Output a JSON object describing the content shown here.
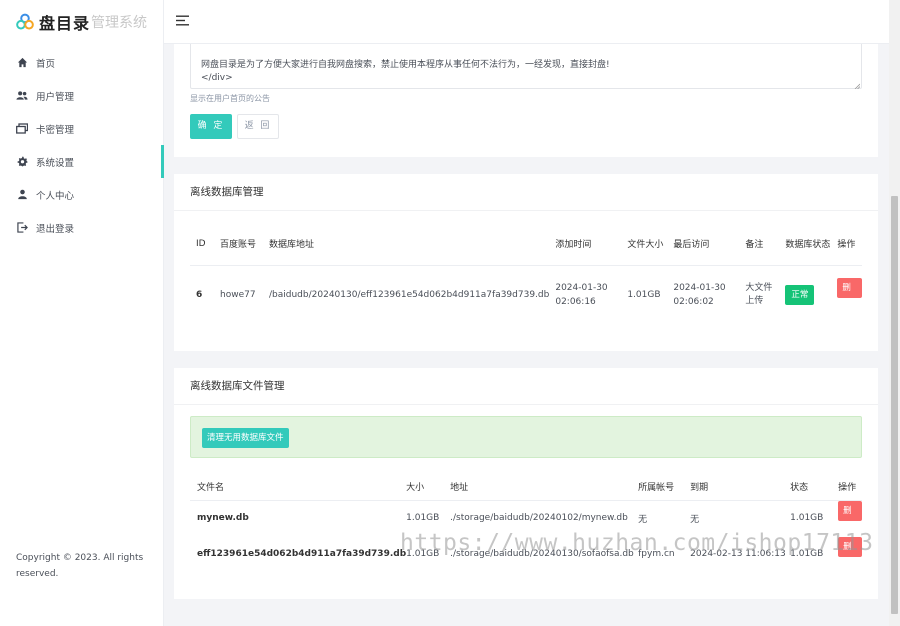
{
  "brand": {
    "name_bold": "盘目录",
    "name_light": "管理系统"
  },
  "sidebar": {
    "items": [
      {
        "label": "首页",
        "icon": "home-icon"
      },
      {
        "label": "用户管理",
        "icon": "users-icon"
      },
      {
        "label": "卡密管理",
        "icon": "cards-icon"
      },
      {
        "label": "系统设置",
        "icon": "gear-icon",
        "active": true
      },
      {
        "label": "个人中心",
        "icon": "person-icon"
      },
      {
        "label": "退出登录",
        "icon": "logout-icon"
      }
    ],
    "copyright": "Copyright © 2023. All rights reserved."
  },
  "notice": {
    "text_line1": "网盘目录是为了方便大家进行自我网盘搜索，禁止使用本程序从事任何不法行为，一经发现，直接封盘!",
    "text_line2": "</div>",
    "hint": "显示在用户首页的公告",
    "ok_label": "确 定",
    "back_label": "返 回"
  },
  "db_card": {
    "title": "离线数据库管理",
    "headers": [
      "ID",
      "百度账号",
      "数据库地址",
      "添加时间",
      "文件大小",
      "最后访问",
      "备注",
      "数据库状态",
      "操作"
    ],
    "rows": [
      {
        "id": "6",
        "account": "howe77",
        "path": "/baidudb/20240130/eff123961e54d062b4d911a7fa39d739.db",
        "added": "2024-01-30 02:06:16",
        "size": "1.01GB",
        "last_access": "2024-01-30 02:06:02",
        "remark": "大文件上传",
        "status": "正常",
        "action": "删除"
      }
    ]
  },
  "file_card": {
    "title": "离线数据库文件管理",
    "clean_label": "清理无用数据库文件",
    "headers": [
      "文件名",
      "大小",
      "地址",
      "所属帐号",
      "到期",
      "状态",
      "操作"
    ],
    "rows": [
      {
        "name": "mynew.db",
        "size": "1.01GB",
        "path": "./storage/baidudb/20240102/mynew.db",
        "owner": "无",
        "expire": "无",
        "status": "1.01GB",
        "action": "删除"
      },
      {
        "name": "eff123961e54d062b4d911a7fa39d739.db",
        "size": "1.01GB",
        "path": "./storage/baidudb/20240130/sofaofsa.db",
        "owner": "fpym.cn",
        "expire": "2024-02-13 11:06:13",
        "status": "1.01GB",
        "action": "删除"
      }
    ]
  },
  "watermark": "https://www.huzhan.com/ishop17113",
  "colors": {
    "accent": "#33cabb",
    "success": "#15c377",
    "danger": "#f96868",
    "alert_bg": "#e3f4df"
  }
}
